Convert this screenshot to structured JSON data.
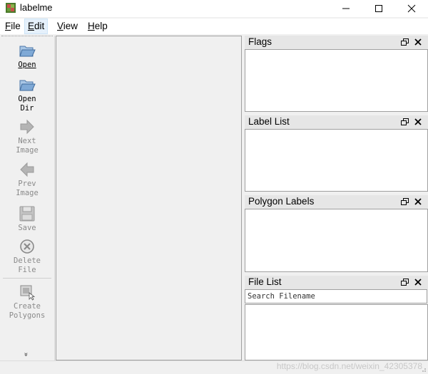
{
  "window": {
    "title": "labelme",
    "icon": "labelme-app-icon",
    "controls": [
      "minimize-icon",
      "maximize-icon",
      "close-icon"
    ]
  },
  "menubar": {
    "items": [
      {
        "label": "File",
        "mnemonic": "F",
        "rest": "ile"
      },
      {
        "label": "Edit",
        "mnemonic": "E",
        "rest": "dit",
        "active": true
      },
      {
        "label": "View",
        "mnemonic": "V",
        "rest": "iew"
      },
      {
        "label": "Help",
        "mnemonic": "H",
        "rest": "elp"
      }
    ]
  },
  "toolbar": {
    "tools": [
      {
        "label": "Open",
        "icon": "folder-open-icon",
        "enabled": true
      },
      {
        "label": "Open\nDir",
        "icon": "folder-open-icon",
        "enabled": true
      },
      {
        "label": "Next\nImage",
        "icon": "arrow-right-icon",
        "enabled": false
      },
      {
        "label": "Prev\nImage",
        "icon": "arrow-left-icon",
        "enabled": false
      },
      {
        "label": "Save",
        "icon": "save-icon",
        "enabled": false
      },
      {
        "label": "Delete\nFile",
        "icon": "delete-icon",
        "enabled": false
      },
      {
        "label": "Create\nPolygons",
        "icon": "create-polygon-icon",
        "enabled": false
      }
    ],
    "more": "»"
  },
  "docks": {
    "flags": {
      "title": "Flags"
    },
    "label_list": {
      "title": "Label List"
    },
    "polygon_labels": {
      "title": "Polygon Labels"
    },
    "file_list": {
      "title": "File List",
      "search_placeholder": "Search Filename"
    }
  },
  "statusbar": {
    "watermark": "https://blog.csdn.net/weixin_42305378"
  },
  "colors": {
    "background": "#f0f0f0",
    "dock_header": "#e6e6e6",
    "menu_active": "#e5f0fb",
    "folder_blue": "#6f9fcf",
    "disabled_gray": "#8a8a8a"
  }
}
